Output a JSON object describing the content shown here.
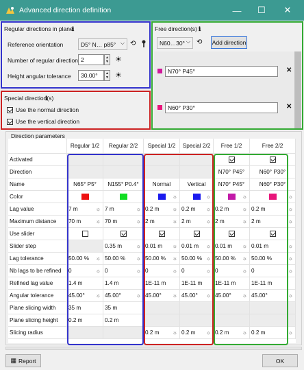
{
  "window": {
    "title": "Advanced direction definition",
    "minimize_glyph": "—",
    "maximize_glyph": "☐",
    "close_glyph": "✕"
  },
  "regular": {
    "header": "Regular directions in plane",
    "info": "ℹ",
    "ref_label": "Reference orientation",
    "ref_value": "D5° N… p85°",
    "num_label": "Number of regular directions",
    "num_value": "2",
    "tol_label": "Height angular tolerance",
    "tol_value": "30.00°"
  },
  "free": {
    "header": "Free direction(s)",
    "info": "ℹ",
    "combo_value": "N60…30°",
    "add_label": "Add direction",
    "items": [
      {
        "label": "N70° P45°",
        "color": "#d0189a"
      },
      {
        "label": "N60° P30°",
        "color": "#e8157a"
      }
    ],
    "remove_glyph": "✕"
  },
  "special": {
    "header": "Special direction(s)",
    "info": "ℹ",
    "normal_label": "Use the normal direction",
    "vertical_label": "Use the vertical direction"
  },
  "params": {
    "header": "Direction parameters",
    "columns": [
      "Regular 1/2",
      "Regular 2/2",
      "Special 1/2",
      "Special 2/2",
      "Free 1/2",
      "Free 2/2"
    ],
    "row_labels": [
      "Activated",
      "Direction",
      "Name",
      "Color",
      "Lag value",
      "Maximum distance",
      "Use slider",
      "Slider step",
      "Lag tolerance",
      "Nb lags to be refined",
      "Refined lag value",
      "Angular tolerance",
      "Plane slicing width",
      "Plane slicing height",
      "Slicing radius"
    ],
    "cells": [
      [
        "",
        "",
        "",
        "",
        "ck",
        "ck"
      ],
      [
        "",
        "",
        "",
        "",
        "N70° P45°",
        "N60° P30°"
      ],
      [
        "N65° P5°",
        "N155° P0.4°",
        "Normal",
        "Vertical",
        "N70° P45°",
        "N60° P30°"
      ],
      [
        "#ee1111",
        "#11dd22",
        "#1a1aee",
        "#1a1aee",
        "#c21aa8",
        "#e8157a"
      ],
      [
        "7 m",
        "7 m",
        "0.2 m",
        "0.2 m",
        "0.2 m",
        "0.2 m"
      ],
      [
        "70 m",
        "70 m",
        "2 m",
        "2 m",
        "2 m",
        "2 m"
      ],
      [
        "cu",
        "ck",
        "ck",
        "ck",
        "ck",
        "ck"
      ],
      [
        "",
        "0.35 m",
        "0.01 m",
        "0.01 m",
        "0.01 m",
        "0.01 m"
      ],
      [
        "50.00 %",
        "50.00 %",
        "50.00 %",
        "50.00 %",
        "50.00 %",
        "50.00 %"
      ],
      [
        "0",
        "0",
        "0",
        "0",
        "0",
        "0"
      ],
      [
        "1.4 m",
        "1.4 m",
        "1E-11 m",
        "1E-11 m",
        "1E-11 m",
        "1E-11 m"
      ],
      [
        "45.00°",
        "45.00°",
        "45.00°",
        "45.00°",
        "45.00°",
        "45.00°"
      ],
      [
        "35 m",
        "35 m",
        "",
        "",
        "",
        ""
      ],
      [
        "0.2 m",
        "0.2 m",
        "",
        "",
        "",
        ""
      ],
      [
        "",
        "",
        "0.2 m",
        "0.2 m",
        "0.2 m",
        "0.2 m"
      ]
    ]
  },
  "footer": {
    "report_label": "Report",
    "ok_label": "OK"
  },
  "colors": {
    "titlebar": "#3c9a92",
    "blue": "#3333cc",
    "red": "#cc2222",
    "green": "#33aa33"
  }
}
